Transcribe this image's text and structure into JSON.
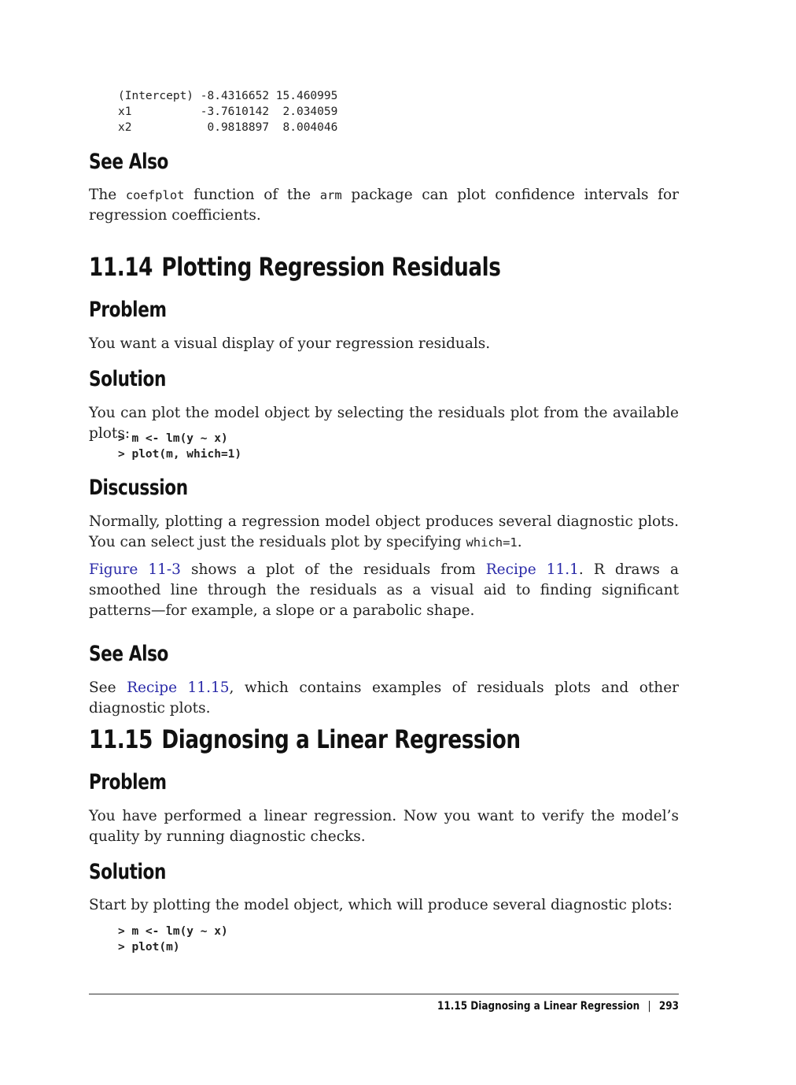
{
  "top_code": {
    "lines": [
      "(Intercept) -8.4316652 15.460995",
      "x1          -3.7610142  2.034059",
      "x2           0.9818897  8.004046"
    ]
  },
  "see_also_1": {
    "heading": "See Also",
    "text_before": "The ",
    "code1": "coefplot",
    "text_mid": " function of the ",
    "code2": "arm",
    "text_after": " package can plot confidence intervals for regression coefficients."
  },
  "section_11_14": {
    "number": "11.14",
    "title": "Plotting Regression Residuals",
    "problem_heading": "Problem",
    "problem_text": "You want a visual display of your regression residuals.",
    "solution_heading": "Solution",
    "solution_text": "You can plot the model object by selecting the residuals plot from the available plots:",
    "solution_code": "> m <- lm(y ~ x)\n> plot(m, which=1)",
    "discussion_heading": "Discussion",
    "discussion_p1_before": "Normally, plotting a regression model object produces several diagnostic plots. You can select just the residuals plot by specifying ",
    "discussion_p1_code": "which=1",
    "discussion_p1_after": ".",
    "discussion_p2_link1": "Figure 11-3",
    "discussion_p2_text1": " shows a plot of the residuals from ",
    "discussion_p2_link2": "Recipe 11.1",
    "discussion_p2_text2": ". R draws a smoothed line through the residuals as a visual aid to finding significant patterns—for example, a slope or a parabolic shape.",
    "see_also_heading": "See Also",
    "see_also_before": "See ",
    "see_also_link": "Recipe 11.15",
    "see_also_after": ", which contains examples of residuals plots and other diagnostic plots."
  },
  "section_11_15": {
    "number": "11.15",
    "title": "Diagnosing a Linear Regression",
    "problem_heading": "Problem",
    "problem_text": "You have performed a linear regression. Now you want to verify the model’s quality by running diagnostic checks.",
    "solution_heading": "Solution",
    "solution_text": "Start by plotting the model object, which will produce several diagnostic plots:",
    "solution_code": "> m <- lm(y ~ x)\n> plot(m)"
  },
  "footer": {
    "running_head": "11.15  Diagnosing a Linear Regression",
    "separator": "|",
    "page_number": "293"
  },
  "colors": {
    "link": "#2a2aa8",
    "text": "#222222"
  }
}
